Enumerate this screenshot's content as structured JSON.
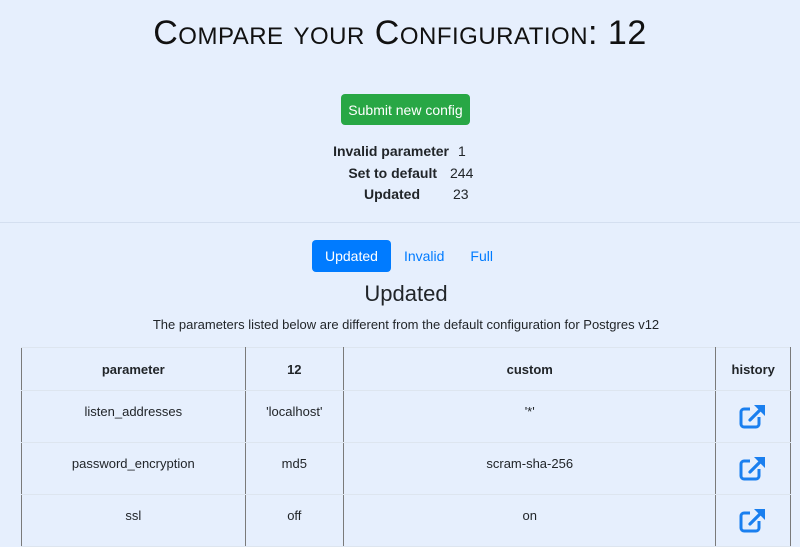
{
  "header": {
    "title": "Compare your Configuration: 12",
    "submit_label": "Submit new config"
  },
  "stats": [
    {
      "label": "Invalid parameter",
      "value": "1"
    },
    {
      "label": "Set to default",
      "value": "244"
    },
    {
      "label": "Updated",
      "value": "23"
    }
  ],
  "tabs": [
    {
      "label": "Updated",
      "active": true
    },
    {
      "label": "Invalid",
      "active": false
    },
    {
      "label": "Full",
      "active": false
    }
  ],
  "section": {
    "title": "Updated",
    "description": "The parameters listed below are different from the default configuration for Postgres v12"
  },
  "table": {
    "headers": [
      "parameter",
      "12",
      "custom",
      "history"
    ],
    "rows": [
      {
        "parameter": "listen_addresses",
        "default": "'localhost'",
        "custom": "'*'",
        "history_icon": "external-link-icon"
      },
      {
        "parameter": "password_encryption",
        "default": "md5",
        "custom": "scram-sha-256",
        "history_icon": "external-link-icon"
      },
      {
        "parameter": "ssl",
        "default": "off",
        "custom": "on",
        "history_icon": "external-link-icon"
      }
    ]
  },
  "colors": {
    "background": "#e6effd",
    "submit": "#28a745",
    "accent": "#007bff"
  }
}
